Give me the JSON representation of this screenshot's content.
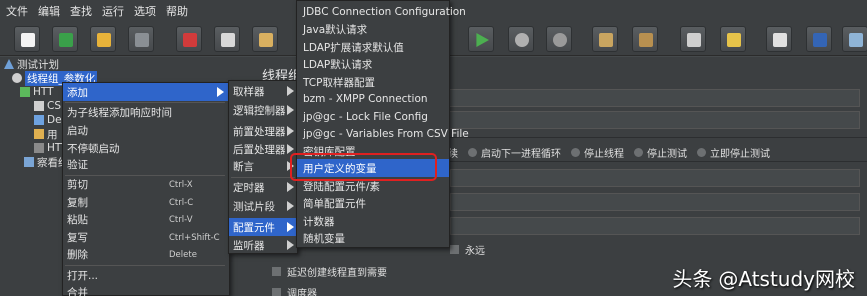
{
  "menubar": [
    "文件",
    "编辑",
    "查找",
    "运行",
    "选项",
    "帮助"
  ],
  "tree": {
    "test_plan": "测试计划",
    "thread_group": "线程组_参数化",
    "http_1": "HTT",
    "node_cs": "CS",
    "node_de": "De",
    "node_yong": "用",
    "http_2": "HTT",
    "result_tree": "察看结"
  },
  "content": {
    "panel_title": "线程组",
    "radio_tail": "续",
    "radios": [
      "启动下一进程循环",
      "停止线程",
      "停止测试",
      "立即停止测试"
    ],
    "perm_text": "永远",
    "delay_checkbox": "延迟创建线程直到需要",
    "scheduler_checkbox": "调度器"
  },
  "context_menu": {
    "add": "添加",
    "add_response_time": "为子线程添加响应时间",
    "start": "启动",
    "start_no_pause": "不停顿启动",
    "validate": "验证",
    "cut": "剪切",
    "cut_sc": "Ctrl-X",
    "copy": "复制",
    "copy_sc": "Ctrl-C",
    "paste": "粘贴",
    "paste_sc": "Ctrl-V",
    "duplicate": "复写",
    "duplicate_sc": "Ctrl+Shift-C",
    "delete": "删除",
    "delete_sc": "Delete",
    "open": "打开...",
    "merge": "合并"
  },
  "add_submenu": {
    "sampler": "取样器",
    "logic_controller": "逻辑控制器",
    "pre_processor": "前置处理器",
    "post_processor": "后置处理器",
    "assertion": "断言",
    "timer": "定时器",
    "test_fragment": "测试片段",
    "config_element": "配置元件",
    "listener": "监听器"
  },
  "config_submenu": {
    "jdbc": "JDBC Connection Configuration",
    "java_default": "Java默认请求",
    "ldap_ext_default": "LDAP扩展请求默认值",
    "ldap_default": "LDAP默认请求",
    "tcp_sampler_config": "TCP取样器配置",
    "xmpp": "bzm - XMPP Connection",
    "lock_file": "jp@gc - Lock File Config",
    "csv_vars": "jp@gc - Variables From CSV File",
    "keystore": "密钥库配置",
    "user_vars": "用户定义的变量",
    "login_config": "登陆配置元件/素",
    "simple_config": "简单配置元件",
    "counter": "计数器",
    "random_var": "随机变量"
  },
  "watermark": {
    "brand": "头条",
    "account": "@Atstudy网校"
  },
  "colors": {
    "highlight": "#2f65ca",
    "red_box": "#e02020",
    "background": "#3c3f41"
  }
}
